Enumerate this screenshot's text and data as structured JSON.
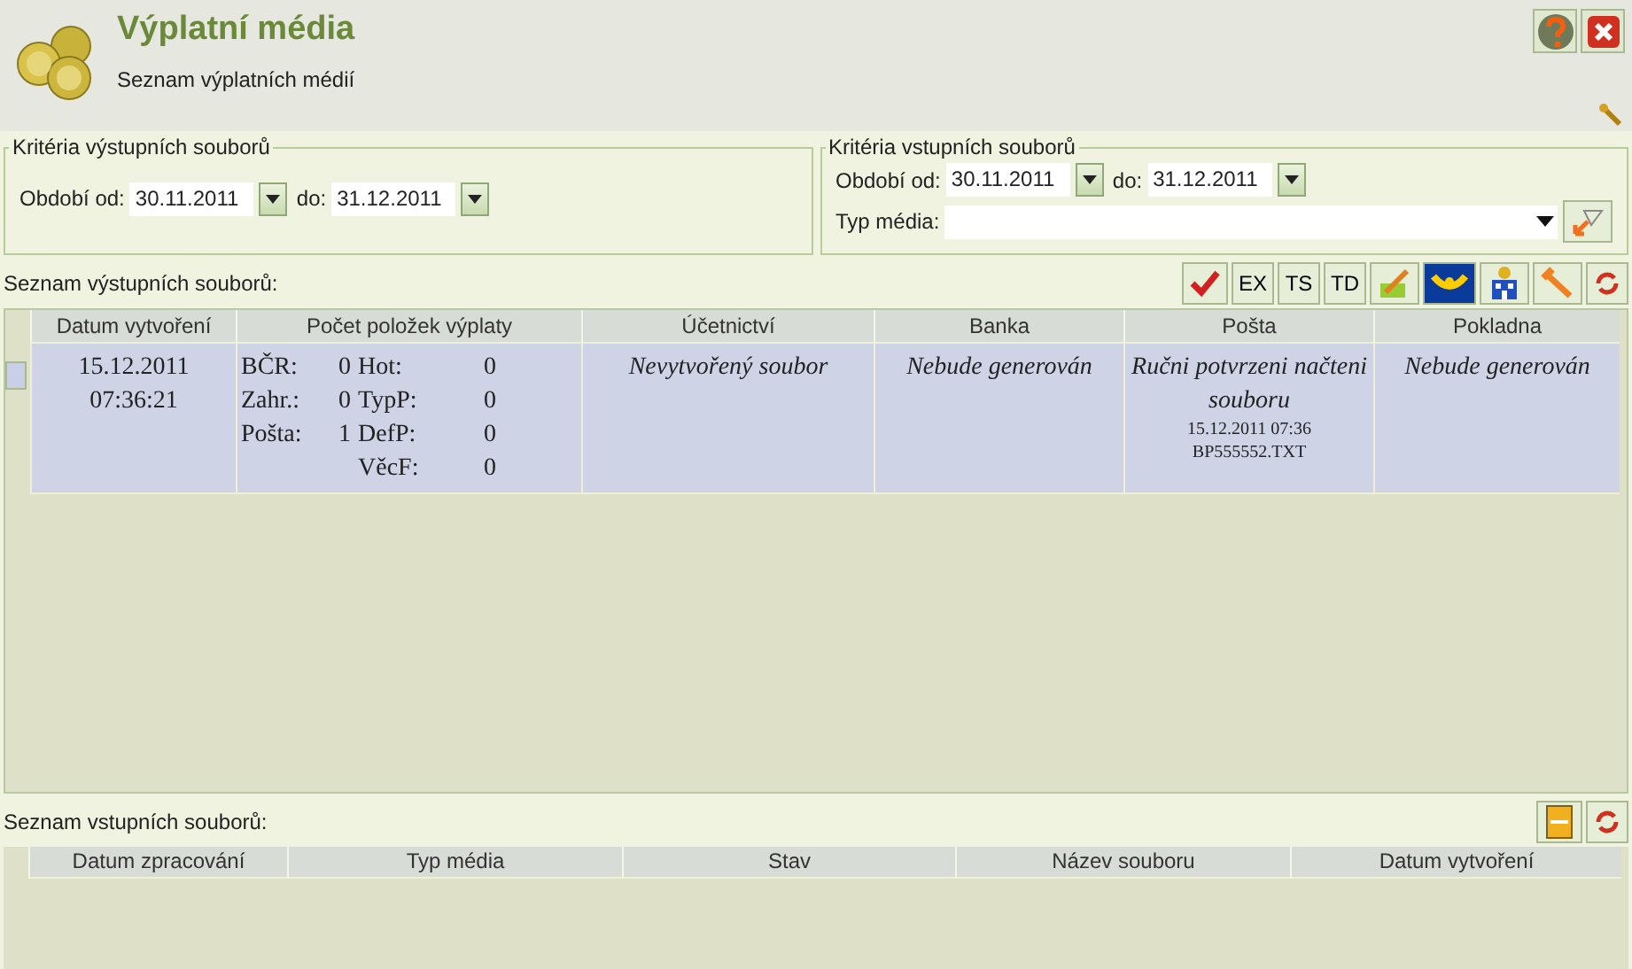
{
  "header": {
    "title": "Výplatní média",
    "subtitle": "Seznam výplatních médií"
  },
  "output_criteria": {
    "legend": "Kritéria výstupních souborů",
    "from_label": "Období od:",
    "from": "30.11.2011",
    "to_label": "do:",
    "to": "31.12.2011"
  },
  "input_criteria": {
    "legend": "Kritéria vstupních souborů",
    "from_label": "Období od:",
    "from": "30.11.2011",
    "to_label": "do:",
    "to": "31.12.2011",
    "media_label": "Typ média:"
  },
  "output_list": {
    "label": "Seznam výstupních souborů:",
    "toolbar": [
      {
        "kind": "check"
      },
      {
        "kind": "text",
        "label": "EX"
      },
      {
        "kind": "text",
        "label": "TS"
      },
      {
        "kind": "text",
        "label": "TD"
      },
      {
        "kind": "edit"
      },
      {
        "kind": "horn"
      },
      {
        "kind": "bank"
      },
      {
        "kind": "wrench"
      },
      {
        "kind": "refresh"
      }
    ],
    "columns": [
      "Datum vytvoření",
      "Počet položek výplaty",
      "Účetnictví",
      "Banka",
      "Pošta",
      "Pokladna"
    ],
    "rows": [
      {
        "selected": true,
        "cells": [
          {
            "kind": "lines",
            "lines": [
              "15.12.2011",
              "07:36:21"
            ]
          },
          {
            "kind": "counts",
            "counts_left": [
              {
                "label": "BČR:",
                "value": "0"
              },
              {
                "label": "Zahr.:",
                "value": "0"
              },
              {
                "label": "Pošta:",
                "value": "1"
              }
            ],
            "counts_right": [
              {
                "label": "Hot:",
                "value": "0"
              },
              {
                "label": "TypP:",
                "value": "0"
              },
              {
                "label": "DefP:",
                "value": "0"
              },
              {
                "label": "VěcF:",
                "value": "0"
              }
            ]
          },
          {
            "status": "Nevytvořený soubor"
          },
          {
            "status": "Nebude generován"
          },
          {
            "status": "Ručni potvrzeni načteni souboru",
            "details": [
              "15.12.2011 07:36",
              "BP555552.TXT"
            ]
          },
          {
            "status": "Nebude generován"
          }
        ]
      }
    ]
  },
  "input_list": {
    "label": "Seznam vstupních souborů:",
    "toolbar": [
      {
        "kind": "save"
      },
      {
        "kind": "refresh"
      }
    ],
    "columns": [
      "Datum zpracování",
      "Typ média",
      "Stav",
      "Název souboru",
      "Datum vytvoření"
    ]
  }
}
